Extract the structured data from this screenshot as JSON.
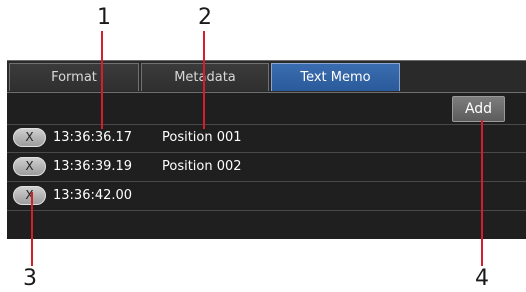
{
  "callouts": [
    "1",
    "2",
    "3",
    "4"
  ],
  "tabs": [
    {
      "label": "Format"
    },
    {
      "label": "Metadata"
    },
    {
      "label": "Text Memo"
    }
  ],
  "add_label": "Add",
  "rows": [
    {
      "delete_label": "X",
      "time": "13:36:36.17",
      "memo": "Position 001"
    },
    {
      "delete_label": "X",
      "time": "13:36:39.19",
      "memo": "Position 002"
    },
    {
      "delete_label": "X",
      "time": "13:36:42.00",
      "memo": ""
    }
  ],
  "colors": {
    "panel_bg": "#1f1f1f",
    "active_tab": "#2f62a4",
    "callout_line": "#d21f2a"
  }
}
